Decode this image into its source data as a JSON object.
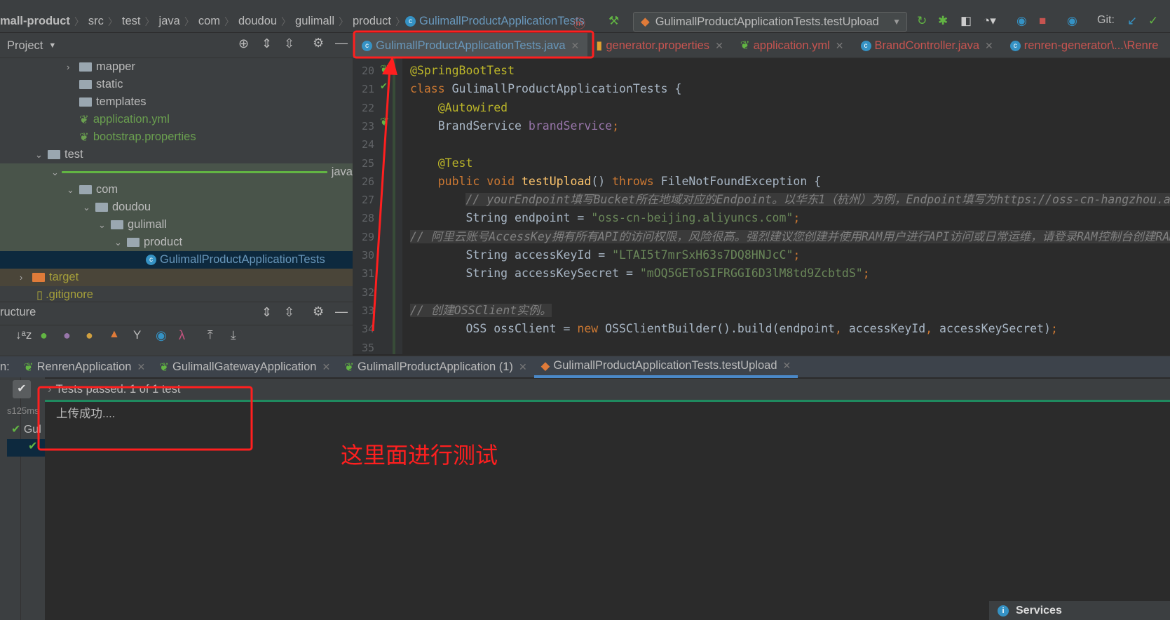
{
  "breadcrumb": [
    "mall-product",
    "src",
    "test",
    "java",
    "com",
    "doudou",
    "gulimall",
    "product",
    "GulimallProductApplicationTests"
  ],
  "toolbar": {
    "run_config": "GulimallProductApplicationTests.testUpload",
    "git_label": "Git:"
  },
  "project_panel": {
    "title": "Project"
  },
  "editor_tabs": [
    {
      "label": "GulimallProductApplicationTests.java",
      "active": true
    },
    {
      "label": "generator.properties"
    },
    {
      "label": "application.yml"
    },
    {
      "label": "BrandController.java"
    },
    {
      "label": "renren-generator\\...\\Renre"
    }
  ],
  "tree": [
    {
      "label": "mapper"
    },
    {
      "label": "static"
    },
    {
      "label": "templates"
    },
    {
      "label": "application.yml"
    },
    {
      "label": "bootstrap.properties"
    },
    {
      "label": "test"
    },
    {
      "label": "java"
    },
    {
      "label": "com"
    },
    {
      "label": "doudou"
    },
    {
      "label": "gulimall"
    },
    {
      "label": "product"
    },
    {
      "label": "GulimallProductApplicationTests"
    },
    {
      "label": "target"
    },
    {
      "label": ".gitignore"
    }
  ],
  "structure_panel": {
    "title": "ructure"
  },
  "code": [
    {
      "n": "20",
      "t": [
        [
          "an",
          "@SpringBootTest"
        ]
      ]
    },
    {
      "n": "21",
      "t": [
        [
          "kw",
          "class "
        ],
        [
          "pl",
          "GulimallProductApplicationTests {"
        ]
      ]
    },
    {
      "n": "22",
      "t": [
        [
          "pl",
          "    "
        ],
        [
          "an",
          "@Autowired"
        ]
      ]
    },
    {
      "n": "23",
      "t": [
        [
          "pl",
          "    BrandService "
        ],
        [
          "fd",
          "brandService"
        ],
        [
          "kw",
          ";"
        ]
      ]
    },
    {
      "n": "24",
      "t": []
    },
    {
      "n": "25",
      "t": [
        [
          "pl",
          "    "
        ],
        [
          "an",
          "@Test"
        ]
      ]
    },
    {
      "n": "26",
      "t": [
        [
          "pl",
          "    "
        ],
        [
          "kw",
          "public void "
        ],
        [
          "mt",
          "testUpload"
        ],
        [
          "pl",
          "() "
        ],
        [
          "kw",
          "throws "
        ],
        [
          "pl",
          "FileNotFoundException {"
        ]
      ]
    },
    {
      "n": "27",
      "t": [
        [
          "pl",
          "        "
        ],
        [
          "cm",
          "// yourEndpoint填写Bucket所在地域对应的Endpoint。以华东1（杭州）为例，Endpoint填写为https://oss-cn-hangzhou.aliyuncs.com。"
        ]
      ]
    },
    {
      "n": "28",
      "t": [
        [
          "pl",
          "        String endpoint = "
        ],
        [
          "st",
          "\"oss-cn-beijing.aliyuncs.com\""
        ],
        [
          "kw",
          ";"
        ]
      ]
    },
    {
      "n": "29",
      "t": [
        [
          "cm",
          "// 阿里云账号AccessKey拥有所有API的访问权限，风险很高。强烈建议您创建并使用RAM用户进行API访问或日常运维，请登录RAM控制台创建RAM用户。"
        ]
      ]
    },
    {
      "n": "30",
      "t": [
        [
          "pl",
          "        String accessKeyId = "
        ],
        [
          "st",
          "\"LTAI5t7mrSxH63s7DQ8HNJcC\""
        ],
        [
          "kw",
          ";"
        ]
      ]
    },
    {
      "n": "31",
      "t": [
        [
          "pl",
          "        String accessKeySecret = "
        ],
        [
          "st",
          "\"mOQ5GEToSIFRGGI6D3lM8td9ZcbtdS\""
        ],
        [
          "kw",
          ";"
        ]
      ]
    },
    {
      "n": "32",
      "t": []
    },
    {
      "n": "33",
      "t": [
        [
          "cm",
          "// 创建OSSClient实例。"
        ]
      ]
    },
    {
      "n": "34",
      "t": [
        [
          "pl",
          "        OSS ossClient = "
        ],
        [
          "kw",
          "new "
        ],
        [
          "pl",
          "OSSClientBuilder().build(endpoint"
        ],
        [
          "kw",
          ", "
        ],
        [
          "pl",
          "accessKeyId"
        ],
        [
          "kw",
          ", "
        ],
        [
          "pl",
          "accessKeySecret)"
        ],
        [
          "kw",
          ";"
        ]
      ]
    },
    {
      "n": "35",
      "t": []
    }
  ],
  "run_panel": {
    "label": "n:",
    "tabs": [
      "RenrenApplication",
      "GulimallGatewayApplication",
      "GulimallProductApplication (1)",
      "GulimallProductApplicationTests.testUpload"
    ],
    "status": "Tests passed: 1 of 1 test",
    "duration": "s125ms",
    "tree_item": "Gul",
    "output": "上传成功...."
  },
  "annotation": "这里面进行测试",
  "services_label": "Services",
  "colors": {
    "annotation_red": "#ff1f1f",
    "test_pass_green": "#1f8a5f",
    "active_tab_underline": "#4a88c7"
  }
}
